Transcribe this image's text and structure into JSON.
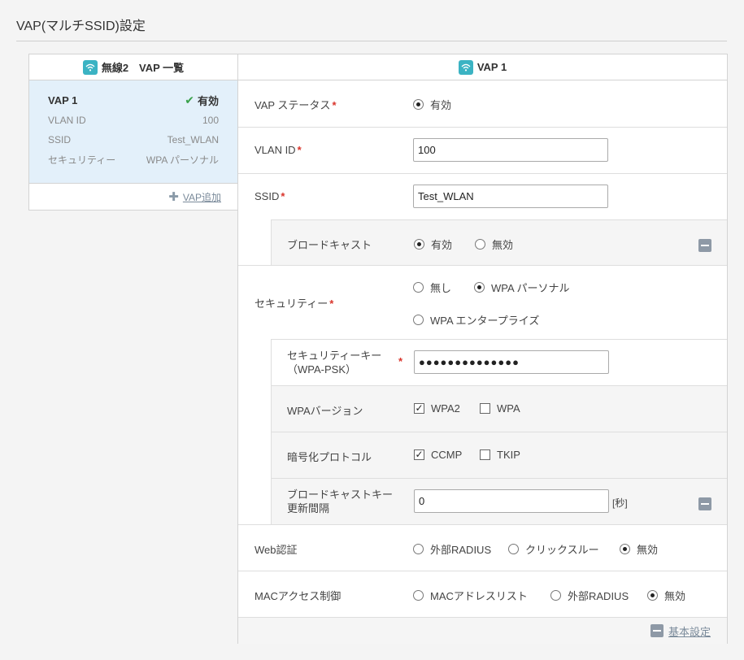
{
  "page": {
    "title": "VAP(マルチSSID)設定"
  },
  "left": {
    "header": "無線2　VAP 一覧",
    "vap": {
      "name": "VAP 1",
      "status": "有効",
      "rows": [
        {
          "label": "VLAN ID",
          "value": "100"
        },
        {
          "label": "SSID",
          "value": "Test_WLAN"
        },
        {
          "label": "セキュリティー",
          "value": "WPA パーソナル"
        }
      ]
    },
    "add_link": "VAP追加"
  },
  "right": {
    "header": "VAP 1",
    "vap_status": {
      "label": "VAP ステータス",
      "option": "有効"
    },
    "vlan_id": {
      "label": "VLAN ID",
      "value": "100"
    },
    "ssid": {
      "label": "SSID",
      "value": "Test_WLAN"
    },
    "broadcast": {
      "label": "ブロードキャスト",
      "options": [
        "有効",
        "無効"
      ],
      "selected": "有効"
    },
    "security": {
      "label": "セキュリティー",
      "options": [
        "無し",
        "WPA パーソナル",
        "WPA エンタープライズ"
      ],
      "selected": "WPA パーソナル"
    },
    "security_key": {
      "label_line1": "セキュリティーキー",
      "label_line2": "（WPA-PSK）",
      "value": "●●●●●●●●●●●●●●"
    },
    "wpa_version": {
      "label": "WPAバージョン",
      "options": [
        "WPA2",
        "WPA"
      ],
      "checked": [
        "WPA2"
      ]
    },
    "encryption": {
      "label": "暗号化プロトコル",
      "options": [
        "CCMP",
        "TKIP"
      ],
      "checked": [
        "CCMP"
      ]
    },
    "broadcast_key": {
      "label_line1": "ブロードキャストキー",
      "label_line2": "更新間隔",
      "value": "0",
      "unit": "[秒]"
    },
    "web_auth": {
      "label": "Web認証",
      "options": [
        "外部RADIUS",
        "クリックスルー",
        "無効"
      ],
      "selected": "無効"
    },
    "mac_access": {
      "label": "MACアクセス制御",
      "options": [
        "MACアドレスリスト",
        "外部RADIUS",
        "無効"
      ],
      "selected": "無効"
    },
    "basic_settings": "基本設定"
  },
  "colors": {
    "accent": "#3bb3c3",
    "required": "#d9342b",
    "selected_card": "#e3f0fa",
    "ok": "#3aa14a"
  },
  "icons": {
    "wifi": "wifi-icon",
    "check": "check-icon",
    "plus": "plus-icon",
    "minus": "minus-icon"
  }
}
